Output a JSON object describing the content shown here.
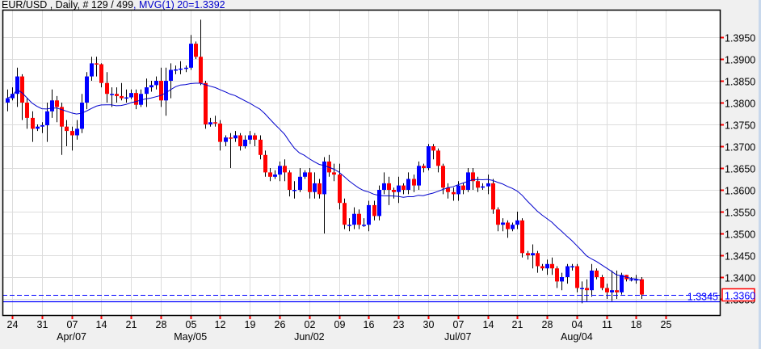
{
  "header": {
    "symbol_info": "EUR/USD , Daily, # 129 / 499",
    "indicator_info": ", MVG(1) 20=1.3392"
  },
  "colors": {
    "up": "#0000ff",
    "down": "#ff0000",
    "wick": "#000000",
    "ma": "#0000cc",
    "grid": "#dcdcdc",
    "tick_mark": "#ff0000"
  },
  "chart_data": {
    "type": "candlestick",
    "title": "EUR/USD Daily",
    "ylim": [
      1.3325,
      1.402
    ],
    "grid": true,
    "y_ticks": [
      "1.3950",
      "1.3900",
      "1.3850",
      "1.3800",
      "1.3750",
      "1.3700",
      "1.3650",
      "1.3600",
      "1.3550",
      "1.3500",
      "1.3450",
      "1.3400",
      "1.3350"
    ],
    "x_ticks": [
      {
        "index": 1,
        "label": "24"
      },
      {
        "index": 7,
        "label": "31"
      },
      {
        "index": 13,
        "label": "07"
      },
      {
        "index": 19,
        "label": "14"
      },
      {
        "index": 25,
        "label": "21"
      },
      {
        "index": 31,
        "label": "28"
      },
      {
        "index": 37,
        "label": "05"
      },
      {
        "index": 43,
        "label": "12"
      },
      {
        "index": 49,
        "label": "19"
      },
      {
        "index": 55,
        "label": "26"
      },
      {
        "index": 61,
        "label": "02"
      },
      {
        "index": 67,
        "label": "09"
      },
      {
        "index": 73,
        "label": "16"
      },
      {
        "index": 79,
        "label": "23"
      },
      {
        "index": 85,
        "label": "30"
      },
      {
        "index": 91,
        "label": "07"
      },
      {
        "index": 97,
        "label": "14"
      },
      {
        "index": 103,
        "label": "21"
      },
      {
        "index": 109,
        "label": "28"
      },
      {
        "index": 115,
        "label": "04"
      },
      {
        "index": 121,
        "label": "11"
      },
      {
        "index": 127,
        "label": "18"
      },
      {
        "index": 133,
        "label": "25"
      }
    ],
    "month_labels": [
      {
        "index": 13,
        "label": "Apr/07"
      },
      {
        "index": 37,
        "label": "May/05"
      },
      {
        "index": 61,
        "label": "Jun/02"
      },
      {
        "index": 91,
        "label": "Jul/07"
      },
      {
        "index": 115,
        "label": "Aug/04"
      }
    ],
    "ma_period": 20,
    "ma_label": "MVG(1) 20",
    "current_price": "1.3360",
    "reference_line": {
      "value": 1.3345,
      "label": "1.3345"
    },
    "candles": [
      [
        1.38,
        1.383,
        1.378,
        1.381
      ],
      [
        1.381,
        1.3835,
        1.3805,
        1.382
      ],
      [
        1.382,
        1.388,
        1.379,
        1.386
      ],
      [
        1.386,
        1.3865,
        1.376,
        1.38
      ],
      [
        1.38,
        1.381,
        1.374,
        1.3765
      ],
      [
        1.3765,
        1.378,
        1.371,
        1.374
      ],
      [
        1.374,
        1.375,
        1.3735,
        1.3745
      ],
      [
        1.3745,
        1.3755,
        1.373,
        1.3748
      ],
      [
        1.3748,
        1.38,
        1.371,
        1.378
      ],
      [
        1.378,
        1.383,
        1.3765,
        1.3805
      ],
      [
        1.3805,
        1.3815,
        1.3755,
        1.379
      ],
      [
        1.379,
        1.38,
        1.368,
        1.3745
      ],
      [
        1.3745,
        1.376,
        1.37,
        1.3735
      ],
      [
        1.3735,
        1.3745,
        1.369,
        1.3725
      ],
      [
        1.3725,
        1.376,
        1.3715,
        1.374
      ],
      [
        1.374,
        1.382,
        1.373,
        1.38
      ],
      [
        1.38,
        1.387,
        1.3785,
        1.386
      ],
      [
        1.386,
        1.3905,
        1.385,
        1.389
      ],
      [
        1.389,
        1.3905,
        1.386,
        1.3888
      ],
      [
        1.3888,
        1.389,
        1.3835,
        1.3845
      ],
      [
        1.3845,
        1.387,
        1.38,
        1.382
      ],
      [
        1.382,
        1.3835,
        1.379,
        1.382
      ],
      [
        1.382,
        1.3835,
        1.38,
        1.3815
      ],
      [
        1.3815,
        1.3845,
        1.3805,
        1.381
      ],
      [
        1.381,
        1.383,
        1.38,
        1.3812
      ],
      [
        1.3812,
        1.383,
        1.3808,
        1.3822
      ],
      [
        1.3822,
        1.383,
        1.3785,
        1.3795
      ],
      [
        1.3795,
        1.383,
        1.379,
        1.382
      ],
      [
        1.382,
        1.3855,
        1.379,
        1.3835
      ],
      [
        1.3835,
        1.385,
        1.3825,
        1.384
      ],
      [
        1.384,
        1.386,
        1.383,
        1.385
      ],
      [
        1.385,
        1.388,
        1.379,
        1.3805
      ],
      [
        1.3805,
        1.388,
        1.377,
        1.385
      ],
      [
        1.385,
        1.389,
        1.381,
        1.3875
      ],
      [
        1.3875,
        1.3885,
        1.3865,
        1.3876
      ],
      [
        1.3876,
        1.3895,
        1.3865,
        1.3878
      ],
      [
        1.3878,
        1.3885,
        1.387,
        1.388
      ],
      [
        1.388,
        1.3955,
        1.3875,
        1.3935
      ],
      [
        1.3935,
        1.394,
        1.39,
        1.3905
      ],
      [
        1.3905,
        1.399,
        1.384,
        1.3845
      ],
      [
        1.3845,
        1.385,
        1.374,
        1.375
      ],
      [
        1.375,
        1.3765,
        1.3745,
        1.3755
      ],
      [
        1.3755,
        1.377,
        1.3745,
        1.3752
      ],
      [
        1.3752,
        1.376,
        1.369,
        1.371
      ],
      [
        1.371,
        1.3725,
        1.37,
        1.372
      ],
      [
        1.372,
        1.373,
        1.365,
        1.3718
      ],
      [
        1.3718,
        1.3735,
        1.371,
        1.3725
      ],
      [
        1.3725,
        1.373,
        1.369,
        1.37
      ],
      [
        1.37,
        1.3725,
        1.3695,
        1.3715
      ],
      [
        1.3715,
        1.3735,
        1.3705,
        1.3725
      ],
      [
        1.3725,
        1.373,
        1.37,
        1.3715
      ],
      [
        1.3715,
        1.3725,
        1.367,
        1.368
      ],
      [
        1.368,
        1.369,
        1.363,
        1.364
      ],
      [
        1.364,
        1.365,
        1.362,
        1.363
      ],
      [
        1.363,
        1.3645,
        1.3625,
        1.3635
      ],
      [
        1.3635,
        1.3665,
        1.362,
        1.3655
      ],
      [
        1.3655,
        1.367,
        1.362,
        1.364
      ],
      [
        1.364,
        1.3645,
        1.3585,
        1.36
      ],
      [
        1.36,
        1.362,
        1.358,
        1.36
      ],
      [
        1.36,
        1.365,
        1.3595,
        1.363
      ],
      [
        1.363,
        1.3645,
        1.3625,
        1.364
      ],
      [
        1.364,
        1.365,
        1.358,
        1.3595
      ],
      [
        1.3595,
        1.364,
        1.358,
        1.3615
      ],
      [
        1.3615,
        1.3625,
        1.358,
        1.359
      ],
      [
        1.359,
        1.3675,
        1.35,
        1.3665
      ],
      [
        1.3665,
        1.368,
        1.363,
        1.364
      ],
      [
        1.364,
        1.366,
        1.362,
        1.3635
      ],
      [
        1.3635,
        1.366,
        1.3555,
        1.357
      ],
      [
        1.357,
        1.358,
        1.351,
        1.352
      ],
      [
        1.352,
        1.3535,
        1.3505,
        1.352
      ],
      [
        1.352,
        1.356,
        1.351,
        1.3545
      ],
      [
        1.3545,
        1.3555,
        1.351,
        1.352
      ],
      [
        1.352,
        1.3535,
        1.3515,
        1.352
      ],
      [
        1.352,
        1.3575,
        1.3505,
        1.3565
      ],
      [
        1.3565,
        1.3575,
        1.353,
        1.354
      ],
      [
        1.354,
        1.361,
        1.353,
        1.36
      ],
      [
        1.36,
        1.364,
        1.359,
        1.3615
      ],
      [
        1.3615,
        1.363,
        1.3565,
        1.36
      ],
      [
        1.36,
        1.3605,
        1.358,
        1.3595
      ],
      [
        1.3595,
        1.363,
        1.357,
        1.361
      ],
      [
        1.361,
        1.3615,
        1.359,
        1.36
      ],
      [
        1.36,
        1.364,
        1.359,
        1.3625
      ],
      [
        1.3625,
        1.3635,
        1.3595,
        1.361
      ],
      [
        1.361,
        1.3665,
        1.36,
        1.3655
      ],
      [
        1.3655,
        1.366,
        1.364,
        1.365
      ],
      [
        1.365,
        1.3705,
        1.3645,
        1.37
      ],
      [
        1.37,
        1.3705,
        1.367,
        1.369
      ],
      [
        1.369,
        1.3695,
        1.364,
        1.3655
      ],
      [
        1.3655,
        1.366,
        1.359,
        1.3605
      ],
      [
        1.3605,
        1.3615,
        1.358,
        1.3595
      ],
      [
        1.3595,
        1.3605,
        1.3575,
        1.359
      ],
      [
        1.359,
        1.362,
        1.3575,
        1.361
      ],
      [
        1.361,
        1.3615,
        1.359,
        1.36
      ],
      [
        1.36,
        1.365,
        1.3595,
        1.364
      ],
      [
        1.364,
        1.365,
        1.36,
        1.362
      ],
      [
        1.362,
        1.363,
        1.3595,
        1.3605
      ],
      [
        1.3605,
        1.3615,
        1.36,
        1.3608
      ],
      [
        1.3608,
        1.3635,
        1.359,
        1.3615
      ],
      [
        1.3615,
        1.3625,
        1.3545,
        1.3555
      ],
      [
        1.3555,
        1.356,
        1.3505,
        1.352
      ],
      [
        1.352,
        1.3535,
        1.3505,
        1.3525
      ],
      [
        1.3525,
        1.353,
        1.349,
        1.351
      ],
      [
        1.351,
        1.3525,
        1.3505,
        1.352
      ],
      [
        1.352,
        1.355,
        1.351,
        1.353
      ],
      [
        1.353,
        1.3535,
        1.3445,
        1.3455
      ],
      [
        1.3455,
        1.346,
        1.344,
        1.345
      ],
      [
        1.345,
        1.3475,
        1.342,
        1.3455
      ],
      [
        1.3455,
        1.346,
        1.341,
        1.3425
      ],
      [
        1.3425,
        1.343,
        1.3415,
        1.342
      ],
      [
        1.342,
        1.344,
        1.3405,
        1.343
      ],
      [
        1.343,
        1.3445,
        1.3405,
        1.342
      ],
      [
        1.342,
        1.3425,
        1.3375,
        1.339
      ],
      [
        1.339,
        1.341,
        1.337,
        1.34
      ],
      [
        1.34,
        1.343,
        1.3385,
        1.3425
      ],
      [
        1.3425,
        1.343,
        1.3415,
        1.3425
      ],
      [
        1.3425,
        1.343,
        1.3365,
        1.3375
      ],
      [
        1.3375,
        1.339,
        1.334,
        1.3375
      ],
      [
        1.3375,
        1.3395,
        1.3345,
        1.337
      ],
      [
        1.337,
        1.343,
        1.3355,
        1.3415
      ],
      [
        1.3415,
        1.342,
        1.3395,
        1.34
      ],
      [
        1.34,
        1.3405,
        1.337,
        1.3375
      ],
      [
        1.3375,
        1.3385,
        1.335,
        1.3365
      ],
      [
        1.3365,
        1.3415,
        1.3345,
        1.337
      ],
      [
        1.337,
        1.3415,
        1.335,
        1.3365
      ],
      [
        1.3365,
        1.341,
        1.336,
        1.3405
      ],
      [
        1.3405,
        1.3405,
        1.339,
        1.3395
      ],
      [
        1.3395,
        1.34,
        1.339,
        1.3395
      ],
      [
        1.3395,
        1.3405,
        1.3385,
        1.3395
      ],
      [
        1.3395,
        1.34,
        1.335,
        1.336
      ]
    ]
  }
}
